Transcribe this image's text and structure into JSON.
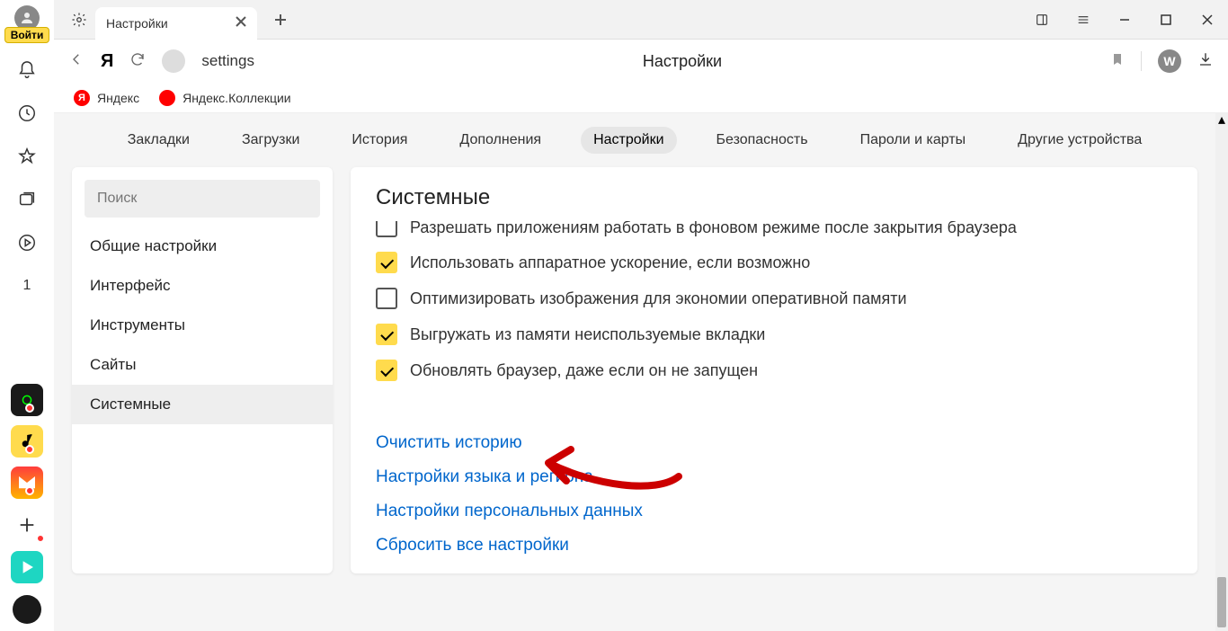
{
  "sidebar": {
    "login_label": "Войти",
    "badge_one": "1"
  },
  "tabstrip": {
    "tab_title": "Настройки"
  },
  "addressbar": {
    "ya_logo": "Я",
    "url_text": "settings",
    "page_title": "Настройки",
    "w_badge": "W"
  },
  "bookmarks": {
    "yandex": "Яндекс",
    "collections": "Яндекс.Коллекции"
  },
  "topnav": {
    "items": [
      "Закладки",
      "Загрузки",
      "История",
      "Дополнения",
      "Настройки",
      "Безопасность",
      "Пароли и карты",
      "Другие устройства"
    ],
    "active_index": 4
  },
  "leftpanel": {
    "search_placeholder": "Поиск",
    "items": [
      "Общие настройки",
      "Интерфейс",
      "Инструменты",
      "Сайты",
      "Системные"
    ],
    "active_index": 4
  },
  "mainpanel": {
    "title": "Системные",
    "options": [
      {
        "label": "Разрешать приложениям работать в фоновом режиме после закрытия браузера",
        "checked": false,
        "clipped": true
      },
      {
        "label": "Использовать аппаратное ускорение, если возможно",
        "checked": true
      },
      {
        "label": "Оптимизировать изображения для экономии оперативной памяти",
        "checked": false
      },
      {
        "label": "Выгружать из памяти неиспользуемые вкладки",
        "checked": true
      },
      {
        "label": "Обновлять браузер, даже если он не запущен",
        "checked": true
      }
    ],
    "links": [
      "Очистить историю",
      "Настройки языка и региона",
      "Настройки персональных данных",
      "Сбросить все настройки"
    ]
  }
}
